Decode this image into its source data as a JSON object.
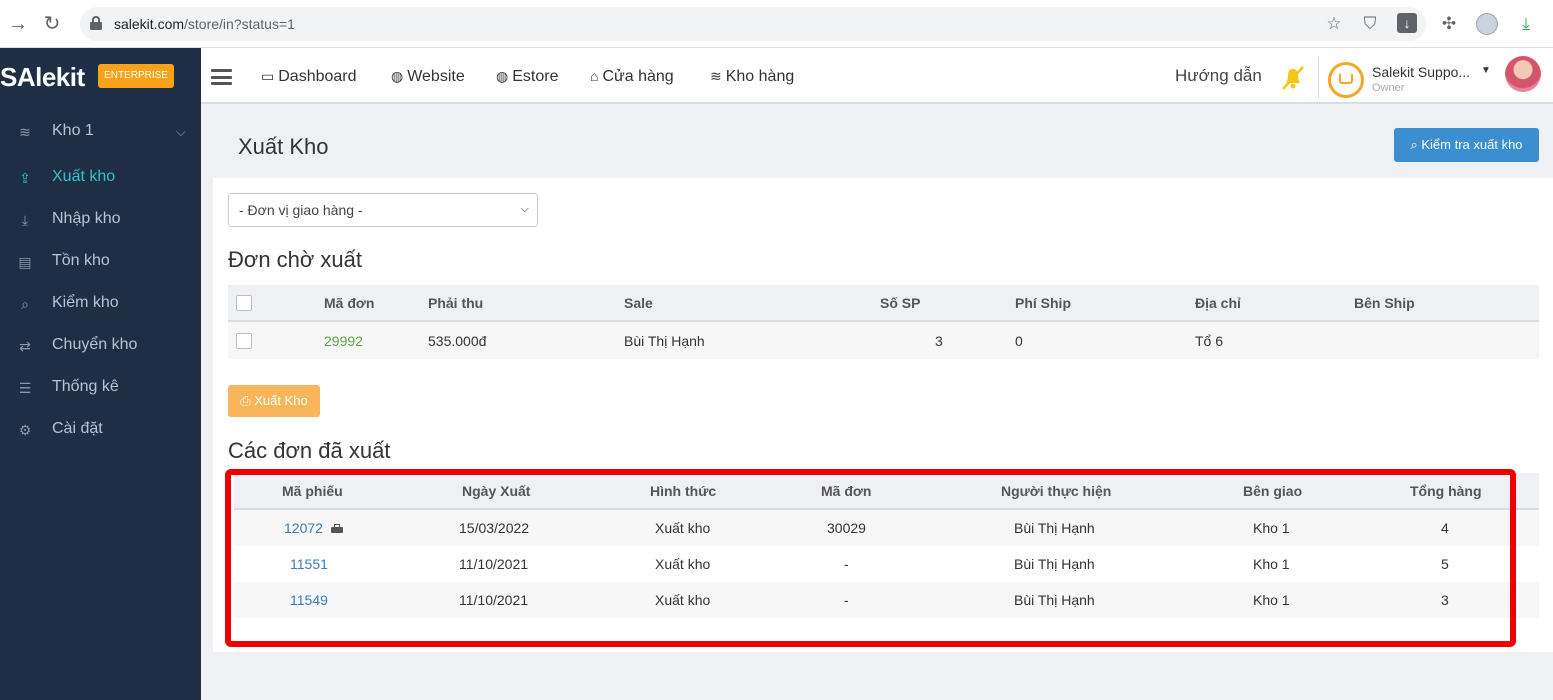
{
  "browser": {
    "url_domain": "salekit.com",
    "url_path": "/store/in?status=1"
  },
  "brand": {
    "logo": "SAlekit",
    "badge": "ENTERPRISE"
  },
  "sidebar": {
    "items": [
      {
        "label": "Kho 1",
        "icon": "layers-icon"
      },
      {
        "label": "Xuất kho",
        "icon": "upload-icon",
        "active": true
      },
      {
        "label": "Nhập kho",
        "icon": "download-icon"
      },
      {
        "label": "Tồn kho",
        "icon": "archive-icon"
      },
      {
        "label": "Kiểm kho",
        "icon": "search-icon"
      },
      {
        "label": "Chuyển kho",
        "icon": "exchange-icon"
      },
      {
        "label": "Thống kê",
        "icon": "list-icon"
      },
      {
        "label": "Cài đặt",
        "icon": "gear-icon"
      }
    ]
  },
  "topnav": {
    "links": [
      {
        "label": "Dashboard",
        "icon": "monitor-icon"
      },
      {
        "label": "Website",
        "icon": "globe-icon"
      },
      {
        "label": "Estore",
        "icon": "globe-icon"
      },
      {
        "label": "Cửa hàng",
        "icon": "store-icon"
      },
      {
        "label": "Kho hàng",
        "icon": "layers-icon"
      }
    ],
    "guide": "Hướng dẫn",
    "user_name": "Salekit Suppo...",
    "user_role": "Owner"
  },
  "page": {
    "title": "Xuất Kho",
    "check_button": "Kiểm tra xuất kho",
    "select_value": "- Đơn vị giao hàng -"
  },
  "pending": {
    "title": "Đơn chờ xuất",
    "headers": [
      "Mã đơn",
      "Phải thu",
      "Sale",
      "Số SP",
      "Phí Ship",
      "Địa chỉ",
      "Bên Ship"
    ],
    "rows": [
      {
        "order": "29992",
        "receivable": "535.000đ",
        "sale": "Bùi Thị Hạnh",
        "qty": "3",
        "ship_fee": "0",
        "address": "Tổ 6",
        "shipper": ""
      }
    ],
    "export_button": "Xuất Kho"
  },
  "exported": {
    "title": "Các đơn đã xuất",
    "headers": [
      "Mã phiếu",
      "Ngày Xuất",
      "Hình thức",
      "Mã đơn",
      "Người thực hiện",
      "Bên giao",
      "Tổng hàng"
    ],
    "rows": [
      {
        "slip": "12072",
        "date": "15/03/2022",
        "type": "Xuất kho",
        "order": "30029",
        "person": "Bùi Thị Hạnh",
        "from": "Kho 1",
        "total": "4"
      },
      {
        "slip": "11551",
        "date": "11/10/2021",
        "type": "Xuất kho",
        "order": "-",
        "person": "Bùi Thị Hạnh",
        "from": "Kho 1",
        "total": "5"
      },
      {
        "slip": "11549",
        "date": "11/10/2021",
        "type": "Xuất kho",
        "order": "-",
        "person": "Bùi Thị Hạnh",
        "from": "Kho 1",
        "total": "3"
      }
    ]
  },
  "colors": {
    "sidebar_bg": "#1f2d45",
    "accent_teal": "#2dc5ca",
    "primary_blue": "#3b8fd0",
    "warning_orange": "#f9b55a",
    "highlight_red": "#ee0000"
  }
}
